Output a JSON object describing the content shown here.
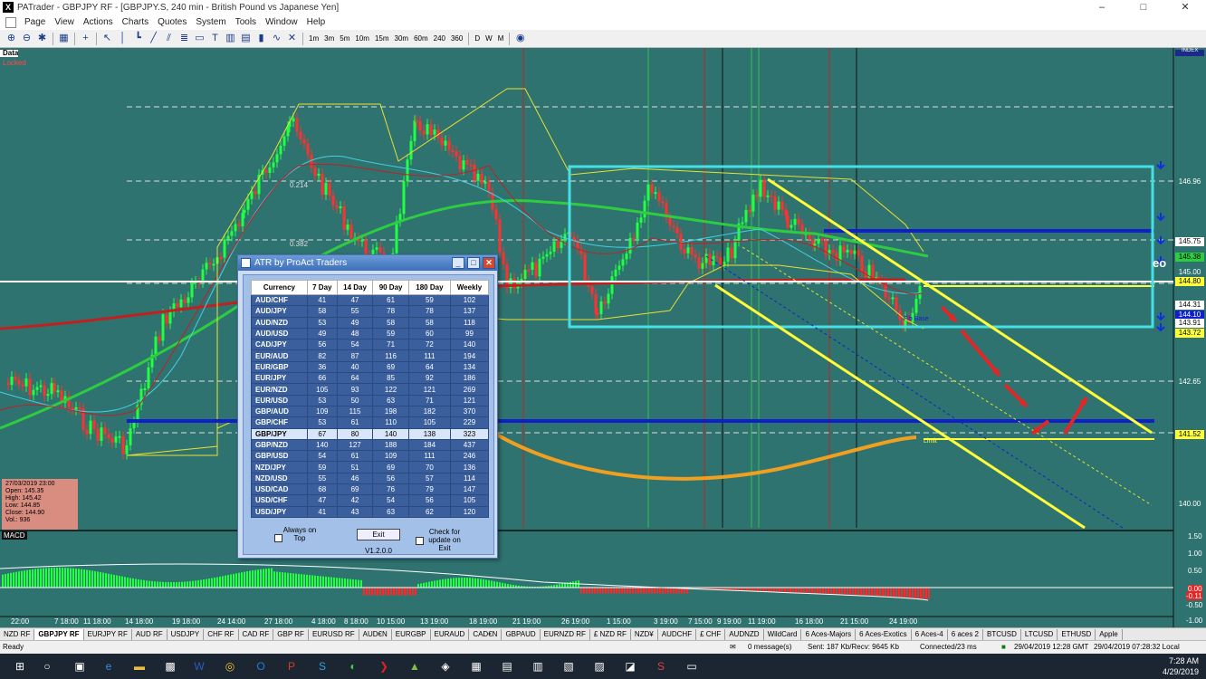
{
  "window": {
    "title": "PATrader - GBPJPY RF - [GBPJPY.S, 240 min - British Pound vs Japanese Yen]",
    "app_icon": "X",
    "min": "–",
    "max": "□",
    "close": "✕"
  },
  "menu": [
    "Page",
    "View",
    "Actions",
    "Charts",
    "Quotes",
    "System",
    "Tools",
    "Window",
    "Help"
  ],
  "toolbar": {
    "timeframes": [
      "1m",
      "3m",
      "5m",
      "10m",
      "15m",
      "30m",
      "60m",
      "240",
      "360",
      "D",
      "W",
      "M"
    ]
  },
  "chart": {
    "data_label": "Data",
    "locked_label": "Locked",
    "index_label": "INDEX",
    "fib_214": "0.214",
    "fib_382": "0.382",
    "fib_label": "Fib Base",
    "limit_label": "Limit",
    "eo_label": "eo",
    "macd_label": "MACD",
    "price_labels": [
      "146.96",
      "145.75",
      "145.38",
      "145.00",
      "144.80",
      "144.31",
      "144.10",
      "143.91",
      "143.72",
      "142.65",
      "141.52",
      "140.00"
    ],
    "macd_labels": [
      "1.50",
      "1.00",
      "0.50",
      "0.00",
      "-0.11",
      "-0.50",
      "-1.00"
    ],
    "date_labels": [
      "22:00",
      "7 18:00",
      "11 18:00",
      "14 18:00",
      "19 18:00",
      "24 14:00",
      "27 18:00",
      "4 18:00",
      "8 18:00",
      "10 15:00",
      "13 19:00",
      "18 19:00",
      "21 19:00",
      "26 19:00",
      "1 15:00",
      "3 19:00",
      "7 15:00",
      "9 19:00",
      "11 19:00",
      "16 18:00",
      "21 15:00",
      "24 19:00"
    ],
    "colors": {
      "background": "#2f7370",
      "box": "#44e0e6",
      "channel": "#ffff3a",
      "blue_level": "#1020c8",
      "arc": "#f0a020",
      "arrows": "#e02828"
    }
  },
  "info_box": {
    "date": "27/03/2019 23:00",
    "open": "Open: 145.35",
    "high": "High: 145.42",
    "low": "Low: 144.85",
    "close": "Close: 144.90",
    "vol": "Vol.: 936"
  },
  "atr_window": {
    "title": "ATR by ProAct Traders",
    "headers": [
      "Currency",
      "7 Day",
      "14 Day",
      "90 Day",
      "180 Day",
      "Weekly"
    ],
    "rows": [
      [
        "AUD/CHF",
        "41",
        "47",
        "61",
        "59",
        "102"
      ],
      [
        "AUD/JPY",
        "58",
        "55",
        "78",
        "78",
        "137"
      ],
      [
        "AUD/NZD",
        "53",
        "49",
        "58",
        "58",
        "118"
      ],
      [
        "AUD/USD",
        "49",
        "48",
        "59",
        "60",
        "99"
      ],
      [
        "CAD/JPY",
        "56",
        "54",
        "71",
        "72",
        "140"
      ],
      [
        "EUR/AUD",
        "82",
        "87",
        "116",
        "111",
        "194"
      ],
      [
        "EUR/GBP",
        "36",
        "40",
        "69",
        "64",
        "134"
      ],
      [
        "EUR/JPY",
        "66",
        "64",
        "85",
        "92",
        "186"
      ],
      [
        "EUR/NZD",
        "105",
        "93",
        "122",
        "121",
        "269"
      ],
      [
        "EUR/USD",
        "53",
        "50",
        "63",
        "71",
        "121"
      ],
      [
        "GBP/AUD",
        "109",
        "115",
        "198",
        "182",
        "370"
      ],
      [
        "GBP/CHF",
        "53",
        "61",
        "110",
        "105",
        "229"
      ],
      [
        "GBP/JPY",
        "67",
        "80",
        "140",
        "138",
        "323"
      ],
      [
        "GBP/NZD",
        "140",
        "127",
        "188",
        "184",
        "437"
      ],
      [
        "GBP/USD",
        "54",
        "61",
        "109",
        "111",
        "246"
      ],
      [
        "NZD/JPY",
        "59",
        "51",
        "69",
        "70",
        "136"
      ],
      [
        "NZD/USD",
        "55",
        "46",
        "56",
        "57",
        "114"
      ],
      [
        "USD/CAD",
        "68",
        "69",
        "76",
        "79",
        "147"
      ],
      [
        "USD/CHF",
        "47",
        "42",
        "54",
        "56",
        "105"
      ],
      [
        "USD/JPY",
        "41",
        "43",
        "63",
        "62",
        "120"
      ]
    ],
    "selected_row": 12,
    "always_on_top": "Always on Top",
    "exit_label": "Exit",
    "check_update": "Check for update on Exit",
    "version": "V1.2.0.0"
  },
  "tabs": [
    "NZD RF",
    "GBPJPY RF",
    "EURJPY RF",
    "AUD RF",
    "USDJPY",
    "CHF RF",
    "CAD RF",
    "GBP RF",
    "EURUSD RF",
    "AUD€N",
    "EURGBP",
    "EURAUD",
    "CAD€N",
    "GBPAUD",
    "EURNZD RF",
    "£ NZD RF",
    "NZD¥",
    "AUDCHF",
    "£ CHF",
    "AUDNZD",
    "WildCard",
    "6 Aces-Majors",
    "6 Aces-Exotics",
    "6 Aces-4",
    "6 aces 2",
    "BTCUSD",
    "LTCUSD",
    "ETHUSD",
    "Apple"
  ],
  "active_tab": 1,
  "status": {
    "ready": "Ready",
    "messages": "0 message(s)",
    "traffic": "Sent: 187 Kb/Recv: 9645 Kb",
    "connected": "Connected/23 ms",
    "gmt": "29/04/2019 12:28 GMT",
    "local": "29/04/2019 07:28:32 Local"
  },
  "taskbar": {
    "time": "7:28 AM",
    "date": "4/29/2019"
  }
}
